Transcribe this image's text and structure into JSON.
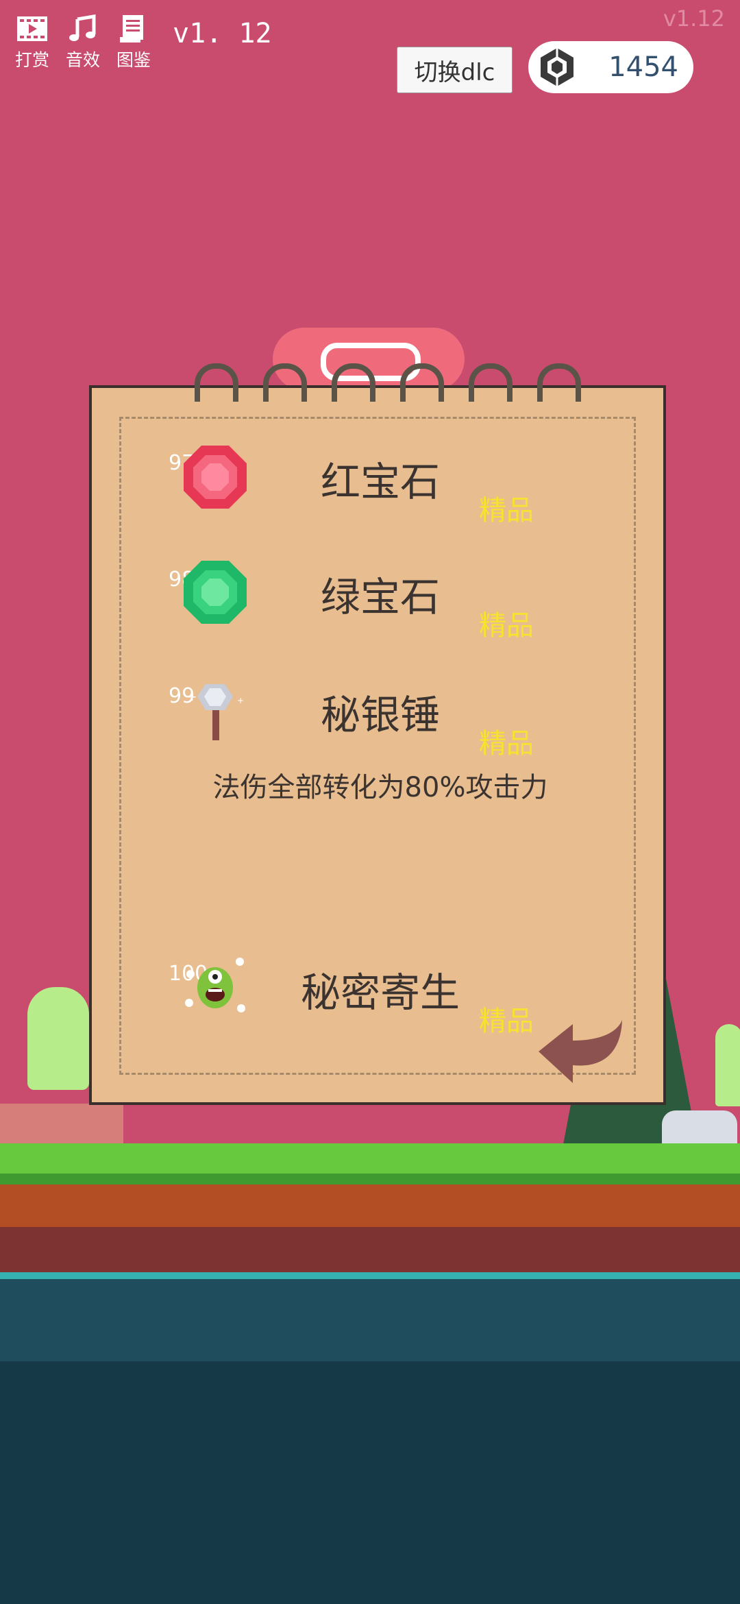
{
  "corner_version": "v1.12",
  "toolbar": {
    "reward_label": "打赏",
    "sound_label": "音效",
    "catalog_label": "图鉴",
    "version": "v1. 12"
  },
  "dlc_button_label": "切换dlc",
  "gems": {
    "count": "1454",
    "icon": "hexagon-gem-icon"
  },
  "items": [
    {
      "num": "97",
      "name": "红宝石",
      "tag": "精品",
      "icon": "ruby-icon"
    },
    {
      "num": "98",
      "name": "绿宝石",
      "tag": "精品",
      "icon": "emerald-icon"
    },
    {
      "num": "99",
      "name": "秘银锤",
      "tag": "精品",
      "icon": "mithril-hammer-icon",
      "description": "法伤全部转化为80%攻击力"
    },
    {
      "num": "100",
      "name": "秘密寄生",
      "tag": "精品",
      "icon": "parasite-icon"
    }
  ],
  "colors": {
    "sky": "#c94c6f",
    "parchment": "#e8bd8f",
    "tag": "#f7e32f"
  }
}
